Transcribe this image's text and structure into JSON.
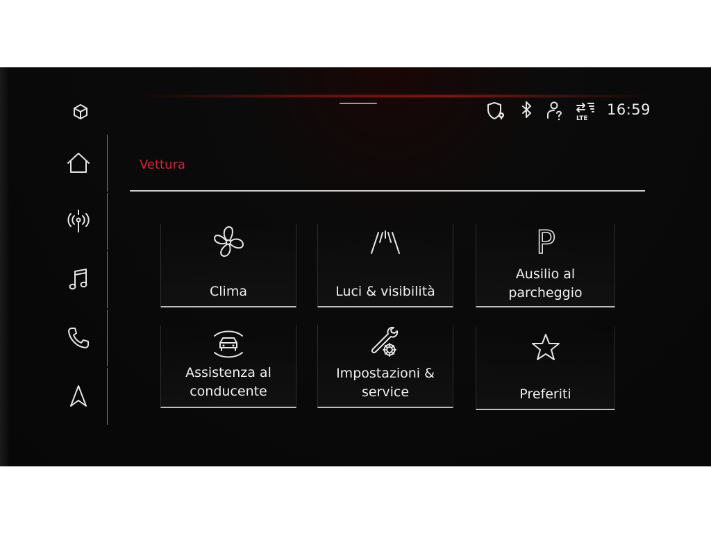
{
  "status_bar": {
    "time": "16:59",
    "lte_label": "LTE",
    "icons": [
      "shield-location-icon",
      "bluetooth-icon",
      "user-help-icon",
      "lte-data-icon"
    ]
  },
  "sidebar": {
    "top_icon": "cube-icon",
    "items": [
      {
        "icon": "home-icon"
      },
      {
        "icon": "radio-antenna-icon"
      },
      {
        "icon": "music-note-icon"
      },
      {
        "icon": "phone-icon"
      },
      {
        "icon": "navigation-arrow-icon"
      }
    ]
  },
  "page": {
    "title": "Vettura",
    "accent_color": "#d3263a"
  },
  "tiles": [
    {
      "icon": "fan-icon",
      "line1": "Clima",
      "line2": ""
    },
    {
      "icon": "road-lights-icon",
      "line1": "Luci & visibilità",
      "line2": ""
    },
    {
      "icon": "parking-icon",
      "icon_text": "P",
      "line1": "Ausilio al",
      "line2": "parcheggio"
    },
    {
      "icon": "driver-assist-icon",
      "line1": "Assistenza al",
      "line2": "conducente"
    },
    {
      "icon": "wrench-gear-icon",
      "line1": "Impostazioni &",
      "line2": "service"
    },
    {
      "icon": "star-icon",
      "line1": "Preferiti",
      "line2": ""
    }
  ]
}
